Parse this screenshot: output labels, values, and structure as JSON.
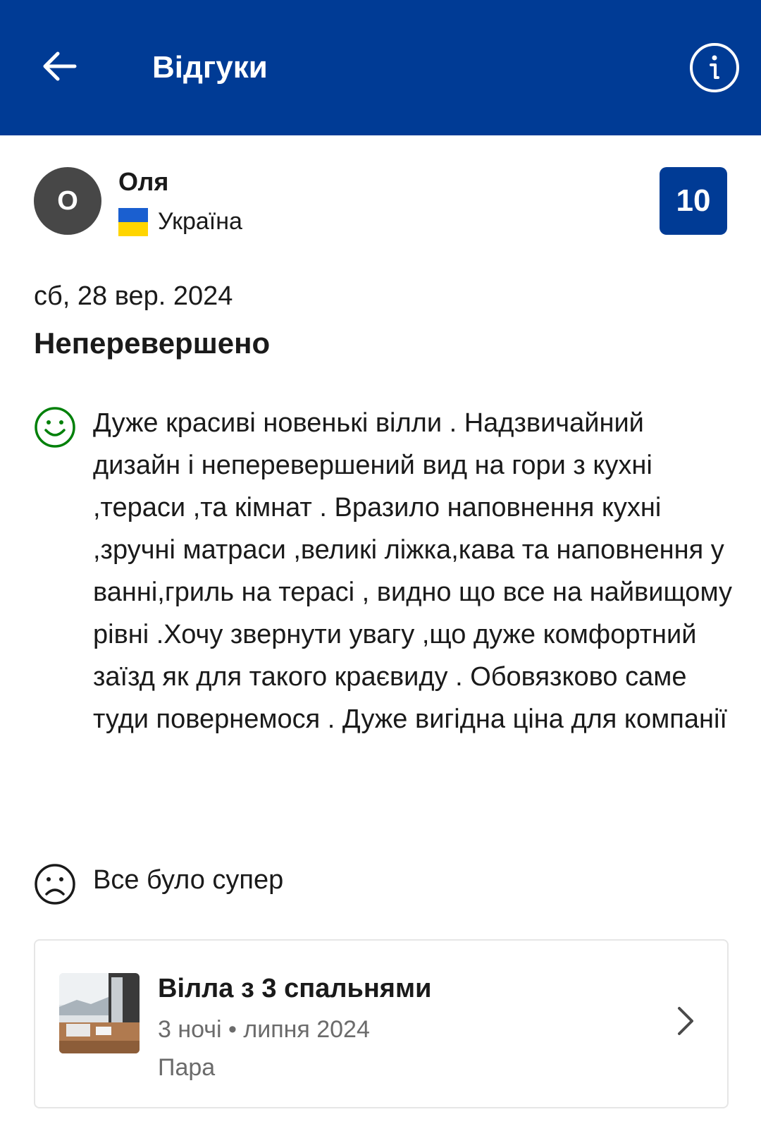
{
  "header": {
    "title": "Відгуки",
    "back_icon": "arrow-left-icon",
    "info_icon": "info-icon",
    "background_color": "#003b95"
  },
  "reviewer": {
    "avatar_letter": "О",
    "name": "Оля",
    "country": "Україна",
    "flag_icon": "ukraine-flag-icon"
  },
  "review": {
    "score": "10",
    "date": "сб, 28 вер. 2024",
    "title": "Неперевершено",
    "positive": "Дуже красиві новенькі вілли . Надзвичайний дизайн і неперевершений вид на гори з кухні ,тераси ,та кімнат . Вразило наповнення кухні ,зручні матраси ,великі ліжка,кава та наповнення у ванні,гриль на терасі , видно що все на найвищому рівні .Хочу звернути увагу ,що дуже комфортний заїзд як для такого краєвиду . Обовязково саме туди повернемося . Дуже вигідна ціна для компанії",
    "negative": "Все було супер",
    "positive_icon": "smiley-face-icon",
    "negative_icon": "sad-face-icon",
    "positive_color": "#008009"
  },
  "room": {
    "name": "Вілла з 3 спальнями",
    "stay": "3 ночі • липня 2024",
    "party": "Пара",
    "chevron_icon": "chevron-right-icon"
  }
}
